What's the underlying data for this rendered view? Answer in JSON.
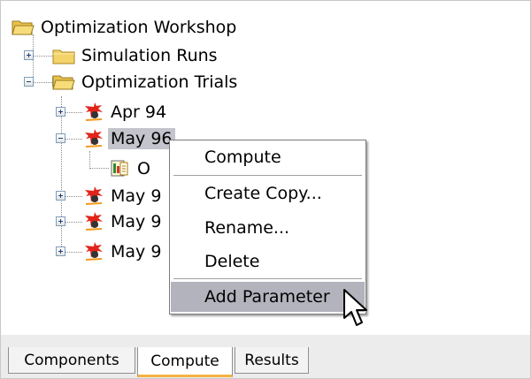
{
  "tree": {
    "root": {
      "label": "Optimization Workshop",
      "icon": "open-folder-icon"
    },
    "simulation_runs": {
      "label": "Simulation Runs",
      "icon": "folder-icon"
    },
    "optimization_trials": {
      "label": "Optimization Trials",
      "icon": "open-folder-icon"
    },
    "trials": [
      {
        "label": "Apr 94",
        "icon": "optimization-trial-icon"
      },
      {
        "label": "May 9",
        "visible_suffix": "6",
        "icon": "optimization-trial-icon"
      },
      {
        "label": "O",
        "icon": "objective-icon"
      },
      {
        "label": "May 9",
        "icon": "optimization-trial-icon"
      },
      {
        "label": "May 9",
        "icon": "optimization-trial-icon"
      },
      {
        "label": "May 9",
        "icon": "optimization-trial-icon"
      }
    ]
  },
  "context_menu": {
    "items": [
      {
        "label": "Compute"
      },
      {
        "label": "Create Copy..."
      },
      {
        "label": "Rename..."
      },
      {
        "label": "Delete"
      },
      {
        "label": "Add Parameter"
      }
    ]
  },
  "tabs": [
    {
      "label": "Components",
      "active": false
    },
    {
      "label": "Compute",
      "active": true
    },
    {
      "label": "Results",
      "active": false
    }
  ],
  "colors": {
    "selection": "#c4c4cc",
    "menu_hover": "#b3b3bd",
    "folder": "#f3d36a",
    "active_tab_accent": "#f5b342",
    "tree_lines": "#8a8a8a"
  }
}
